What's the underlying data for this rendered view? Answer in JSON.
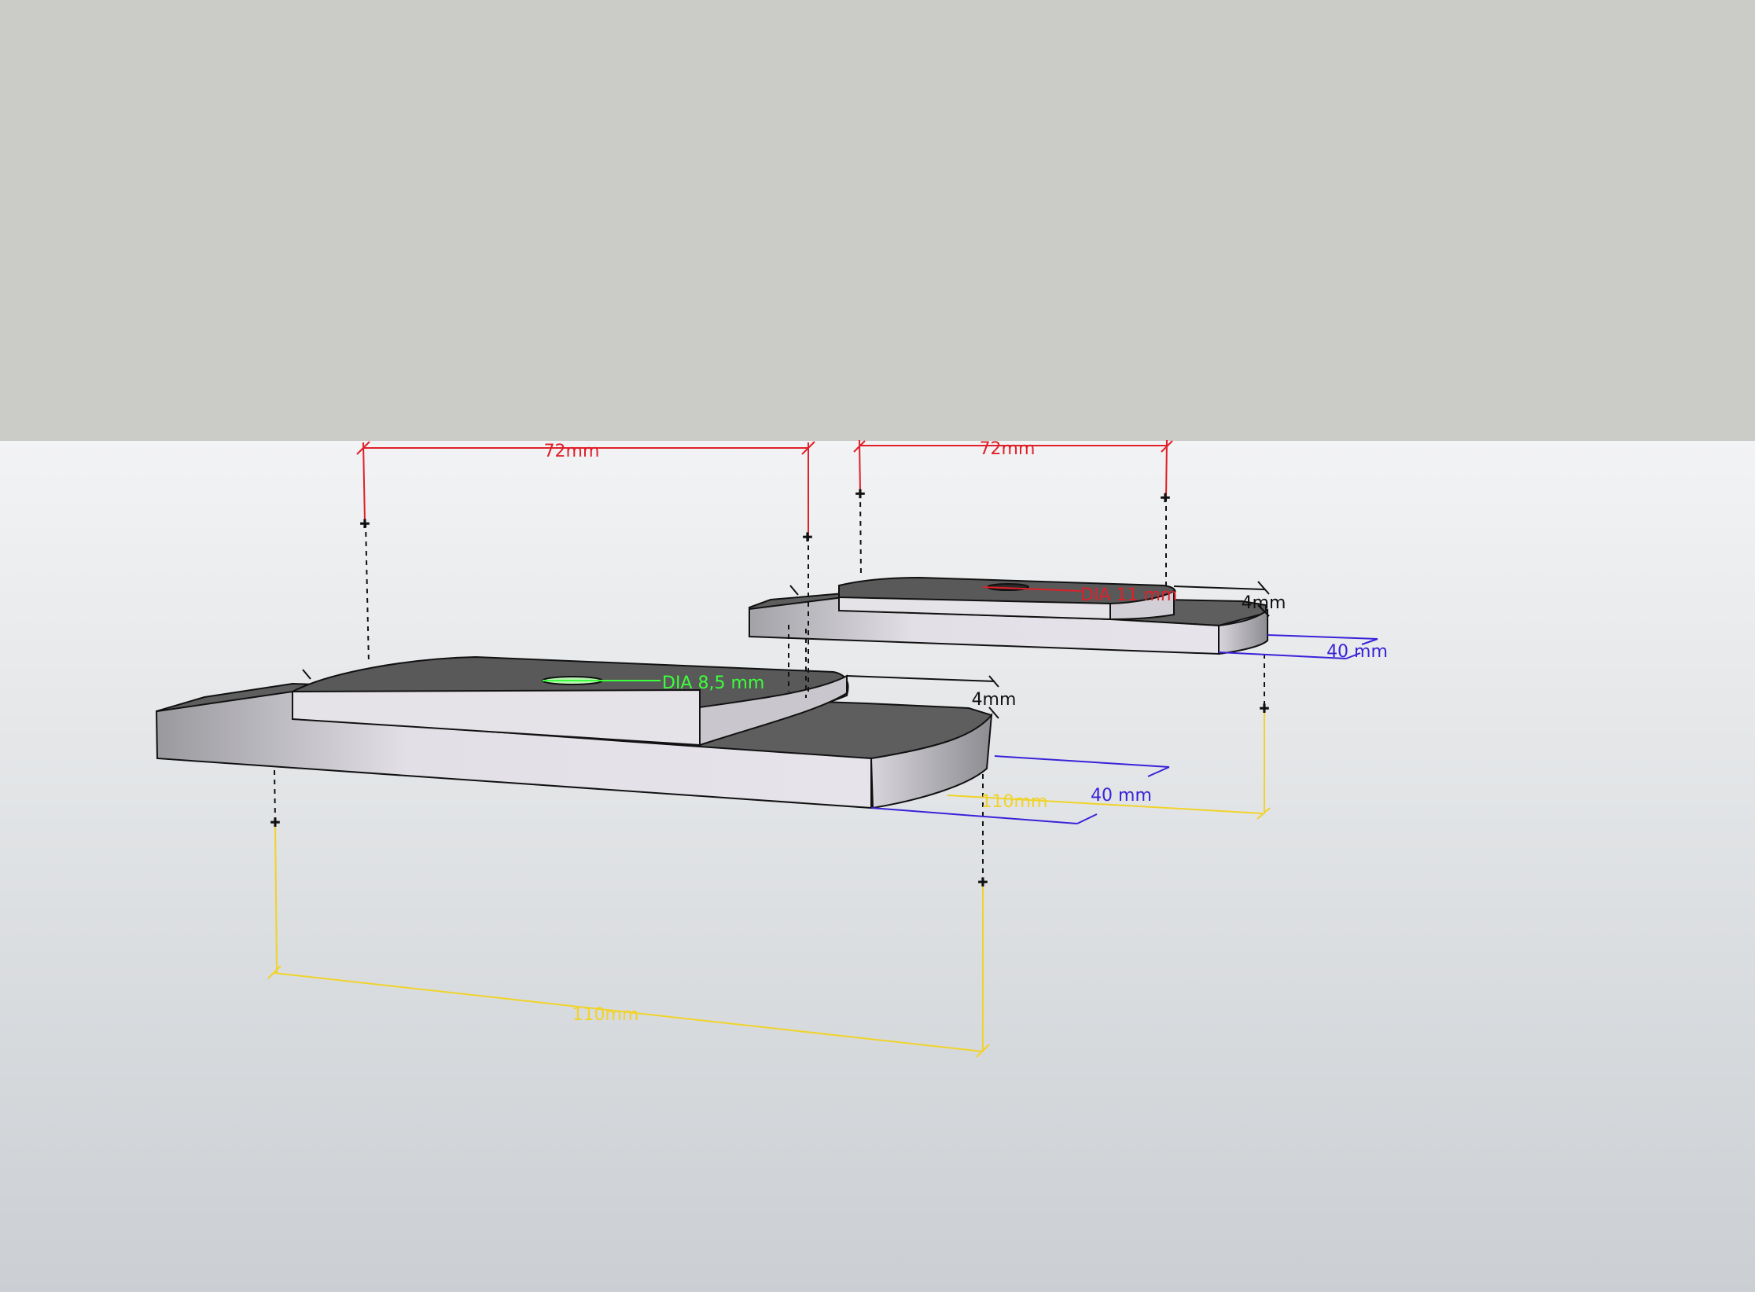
{
  "scene": {
    "sky_color": "#cbccc7",
    "ground_top_color": "#f2f3f4",
    "ground_bottom_color": "#cbcfd3",
    "face_top_color": "#5c5c5c",
    "face_side_light": "#e4e2e7",
    "face_side_dark": "#9a999e"
  },
  "part_large": {
    "width_dim": "72mm",
    "length_dim": "110mm",
    "depth_dim": "40 mm",
    "thickness_dim": "4mm",
    "hole_dim": "DIA 8,5 mm"
  },
  "part_small": {
    "width_dim": "72mm",
    "length_dim": "110mm",
    "depth_dim": "40 mm",
    "thickness_dim": "4mm",
    "hole_dim": "DIA 11 mm"
  },
  "colors": {
    "width_dim": "#e0202a",
    "length_dim": "#f0d32a",
    "depth_dim": "#3a22d8",
    "thickness_dim": "#111111",
    "hole_large": "#3bff3b",
    "hole_small": "#e0202a"
  }
}
